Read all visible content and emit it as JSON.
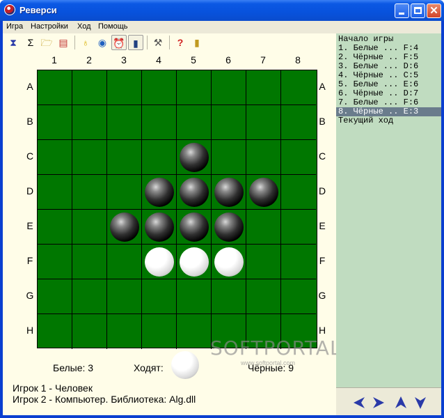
{
  "window": {
    "title": "Реверси"
  },
  "menu": [
    "Игра",
    "Настройки",
    "Ход",
    "Помощь"
  ],
  "toolbar": {
    "icons": [
      "hourglass-icon",
      "sigma-icon",
      "open-folder-icon",
      "save-icon",
      "lightbulb-icon",
      "globe-icon",
      "alarm-clock-icon",
      "bar-chart-icon",
      "tools-icon",
      "help-icon",
      "exit-door-icon"
    ],
    "pressed": [
      "alarm-clock-icon",
      "bar-chart-icon"
    ]
  },
  "board": {
    "columns": [
      "1",
      "2",
      "3",
      "4",
      "5",
      "6",
      "7",
      "8"
    ],
    "rows": [
      "A",
      "B",
      "C",
      "D",
      "E",
      "F",
      "G",
      "H"
    ],
    "colors": {
      "board": "#007700",
      "black": "#000000",
      "white": "#ffffff"
    },
    "discs": [
      {
        "cell": "C5",
        "color": "black"
      },
      {
        "cell": "D4",
        "color": "black"
      },
      {
        "cell": "D5",
        "color": "black"
      },
      {
        "cell": "D6",
        "color": "black"
      },
      {
        "cell": "D7",
        "color": "black"
      },
      {
        "cell": "E3",
        "color": "black"
      },
      {
        "cell": "E4",
        "color": "black"
      },
      {
        "cell": "E5",
        "color": "black"
      },
      {
        "cell": "E6",
        "color": "black"
      },
      {
        "cell": "F4",
        "color": "white"
      },
      {
        "cell": "F5",
        "color": "white"
      },
      {
        "cell": "F6",
        "color": "white"
      }
    ]
  },
  "status": {
    "white_count": "Белые: 3",
    "turn_label": "Ходят:",
    "black_count": "Чёрные: 9",
    "turn_color": "white",
    "player1": "Игрок 1 - Человек",
    "player2": "Игрок 2 - Компьютер. Библиотека: Alg.dll"
  },
  "watermark": {
    "text": "SOFTPORTAL",
    "url": "www.softportal.com"
  },
  "moves": {
    "start": "Начало игры",
    "items": [
      "1. Белые ... F:4",
      "2. Чёрные .. F:5",
      "3. Белые ... D:6",
      "4. Чёрные .. C:5",
      "5. Белые ... E:6",
      "6. Чёрные .. D:7",
      "7. Белые ... F:6",
      "8. Чёрные .. E:3"
    ],
    "selected_index": 7,
    "current": "Текущий ход"
  },
  "nav": {
    "icons": [
      "arrow-left-icon",
      "arrow-right-icon",
      "arrow-up-icon",
      "arrow-down-icon"
    ],
    "color": "#2a3aa8"
  }
}
